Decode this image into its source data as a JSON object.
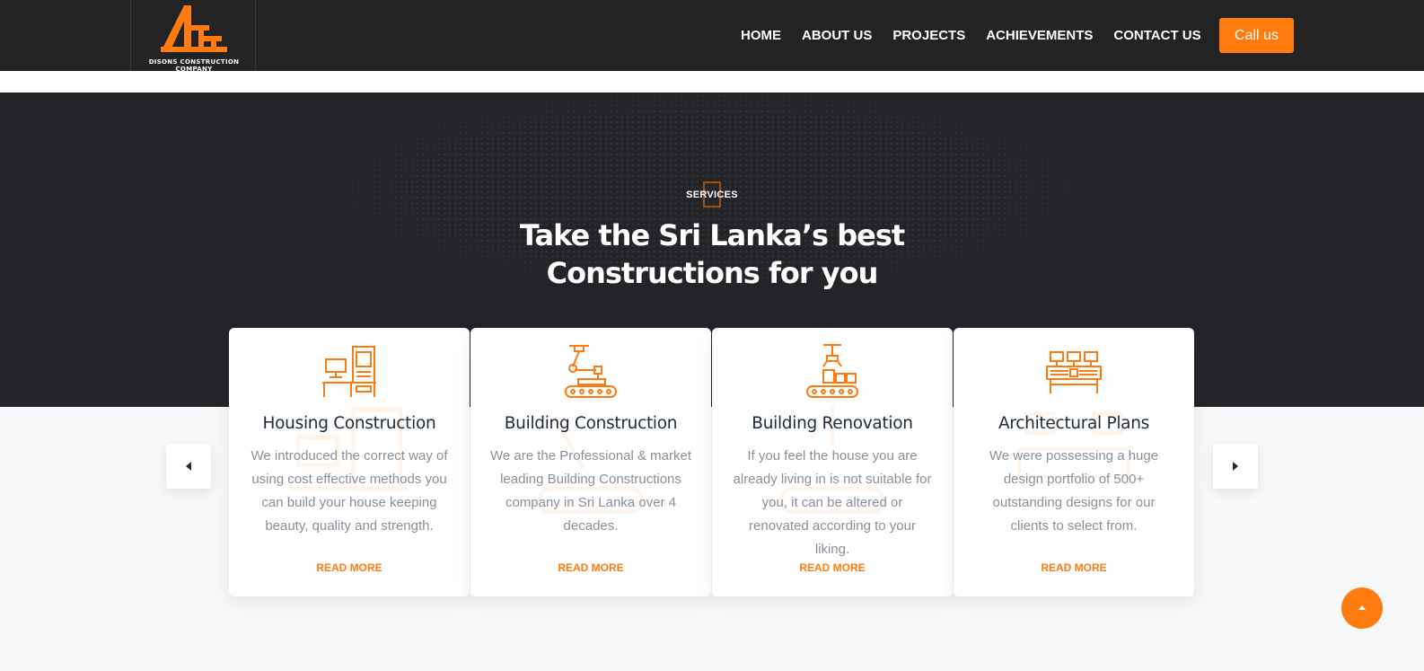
{
  "brand": {
    "name": "DISONS CONSTRUCTION COMPANY",
    "accent_color": "#ff7b0f",
    "dark_color": "#232428"
  },
  "nav": {
    "items": [
      "HOME",
      "ABOUT US",
      "PROJECTS",
      "ACHIEVEMENTS",
      "CONTACT US"
    ],
    "call_label": "Call us"
  },
  "hero": {
    "tag": "SERVICES",
    "title_line1": "Take the Sri Lanka’s best",
    "title_line2": "Constructions for you"
  },
  "services": [
    {
      "icon": "workstation-icon",
      "title": "Housing Construction",
      "text": "We introduced the correct way of using cost effective methods you can build your house keeping beauty, quality and strength.",
      "link": "READ MORE"
    },
    {
      "icon": "robot-arm-icon",
      "title": "Building Construction",
      "text": "We are the Professional & market leading Building Constructions company in Sri Lanka over 4 decades.",
      "link": "READ MORE"
    },
    {
      "icon": "conveyor-icon",
      "title": "Building Renovation",
      "text": "If you feel the house you are already living in is not suitable for you, it can be altered or renovated according to your liking.",
      "link": "READ MORE"
    },
    {
      "icon": "control-panel-icon",
      "title": "Architectural Plans",
      "text": "We were possessing a huge design portfolio of 500+ outstanding designs for our clients to select from.",
      "link": "READ MORE"
    }
  ],
  "controls": {
    "prev_icon": "caret-left-icon",
    "next_icon": "caret-right-icon",
    "scroll_top_icon": "caret-up-icon"
  }
}
